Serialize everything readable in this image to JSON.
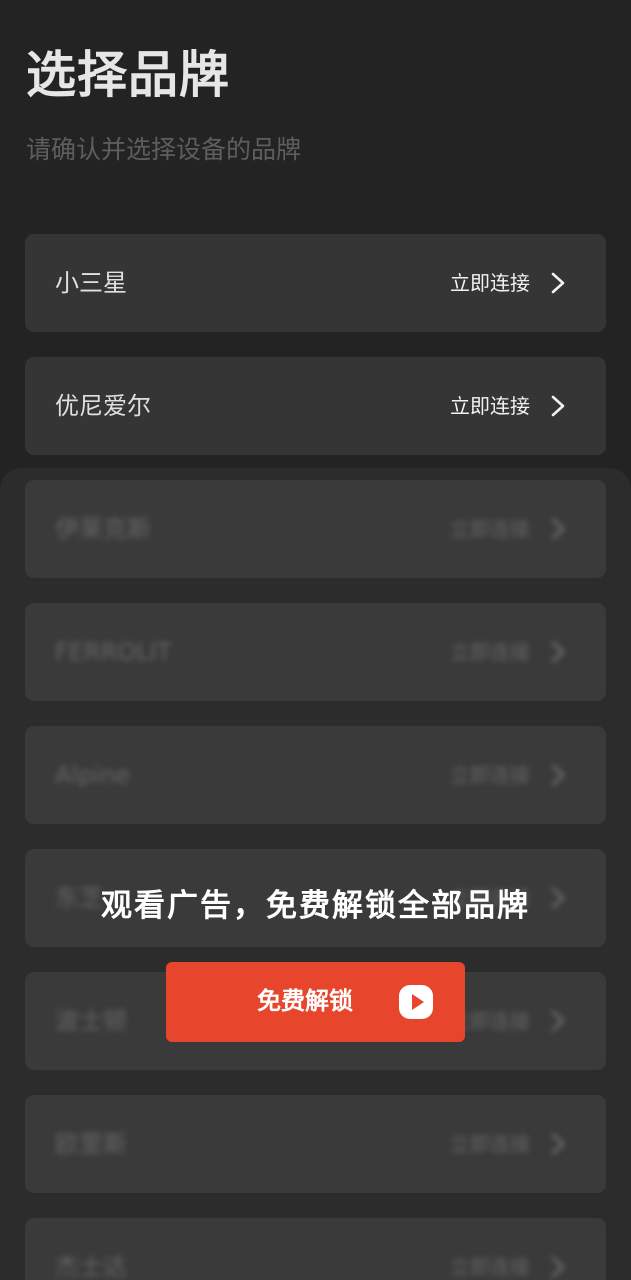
{
  "header": {
    "title": "选择品牌",
    "subtitle": "请确认并选择设备的品牌"
  },
  "brands": [
    {
      "name": "小三星",
      "action": "立即连接",
      "icon": "chevron-right-icon"
    },
    {
      "name": "优尼爱尔",
      "action": "立即连接",
      "icon": "chevron-right-icon"
    }
  ],
  "locked_brands": [
    {
      "name": "伊莱克斯",
      "action": "立即连接",
      "icon": "chevron-right-icon"
    },
    {
      "name": "FERROLIT",
      "action": "立即连接",
      "icon": "chevron-right-icon"
    },
    {
      "name": "Alpine",
      "action": "立即连接",
      "icon": "chevron-right-icon"
    },
    {
      "name": "东芝",
      "action": "立即连接",
      "icon": "chevron-right-icon"
    },
    {
      "name": "波士顿",
      "action": "立即连接",
      "icon": "chevron-right-icon"
    },
    {
      "name": "欧里斯",
      "action": "立即连接",
      "icon": "chevron-right-icon"
    },
    {
      "name": "杰士达",
      "action": "立即连接",
      "icon": "chevron-right-icon"
    }
  ],
  "unlock": {
    "message": "观看广告，免费解锁全部品牌",
    "button_label": "免费解锁",
    "button_icon": "play-video-icon"
  },
  "colors": {
    "background": "#232323",
    "card": "#353535",
    "overlay": "#2c2c2c",
    "accent": "#e7452c"
  }
}
